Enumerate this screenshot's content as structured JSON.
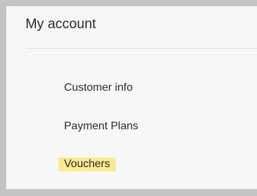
{
  "account_panel": {
    "title": "My account",
    "highlight_color": "#fbea8f",
    "menu": [
      {
        "label": "Customer info"
      },
      {
        "label": "Payment Plans"
      },
      {
        "label": "Vouchers",
        "highlighted": true
      }
    ]
  }
}
